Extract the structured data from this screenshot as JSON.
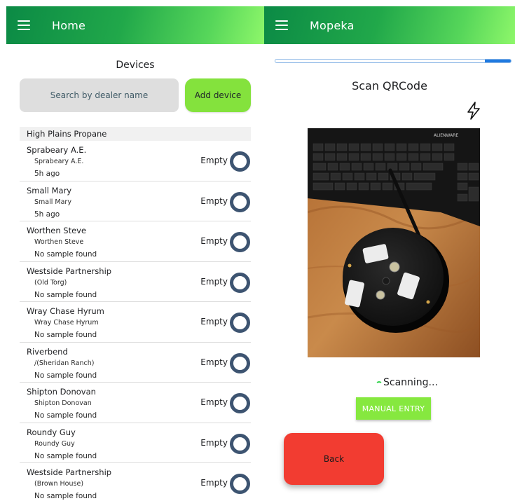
{
  "left_screen": {
    "appbar": {
      "title": "Home",
      "menu_icon": "hamburger-menu-icon"
    },
    "section_title": "Devices",
    "search": {
      "placeholder": "Search by dealer name"
    },
    "add_device_label": "Add device",
    "group_header": "High Plains Propane",
    "devices": [
      {
        "name": "Sprabeary A.E.",
        "sub": "Sprabeary A.E.",
        "time": "5h ago",
        "status": "Empty"
      },
      {
        "name": "Small Mary",
        "sub": "Small Mary",
        "time": "5h ago",
        "status": "Empty"
      },
      {
        "name": "Worthen Steve",
        "sub": "Worthen Steve",
        "time": "No sample found",
        "status": "Empty"
      },
      {
        "name": "Westside Partnership",
        "sub": "(Old Torg)",
        "time": "No sample found",
        "status": "Empty"
      },
      {
        "name": "Wray Chase Hyrum",
        "sub": "Wray Chase Hyrum",
        "time": "No sample found",
        "status": "Empty"
      },
      {
        "name": "Riverbend",
        "sub": "/(Sheridan Ranch)",
        "time": "No sample found",
        "status": "Empty"
      },
      {
        "name": "Shipton Donovan",
        "sub": "Shipton Donovan",
        "time": "No sample found",
        "status": "Empty"
      },
      {
        "name": "Roundy Guy",
        "sub": "Roundy Guy",
        "time": "No sample found",
        "status": "Empty"
      },
      {
        "name": "Westside Partnership",
        "sub": "(Brown House)",
        "time": "No sample found",
        "status": "Empty"
      }
    ]
  },
  "right_screen": {
    "appbar": {
      "title": "Mopeka",
      "menu_icon": "hamburger-menu-icon"
    },
    "progress_percent": 11,
    "scan_title": "Scan QRCode",
    "flash_icon": "lightning-bolt-icon",
    "camera_overlay_text": "ALIENWARE",
    "scanning_text": "Scanning...",
    "manual_entry_label": "MANUAL ENTRY",
    "back_label": "Back"
  },
  "colors": {
    "appbar_start": "#0b8a45",
    "appbar_end": "#8ef76a",
    "add_button": "#84e23d",
    "ring": "#3d5471",
    "progress": "#1f7ae0",
    "back_button": "#f23c31"
  }
}
